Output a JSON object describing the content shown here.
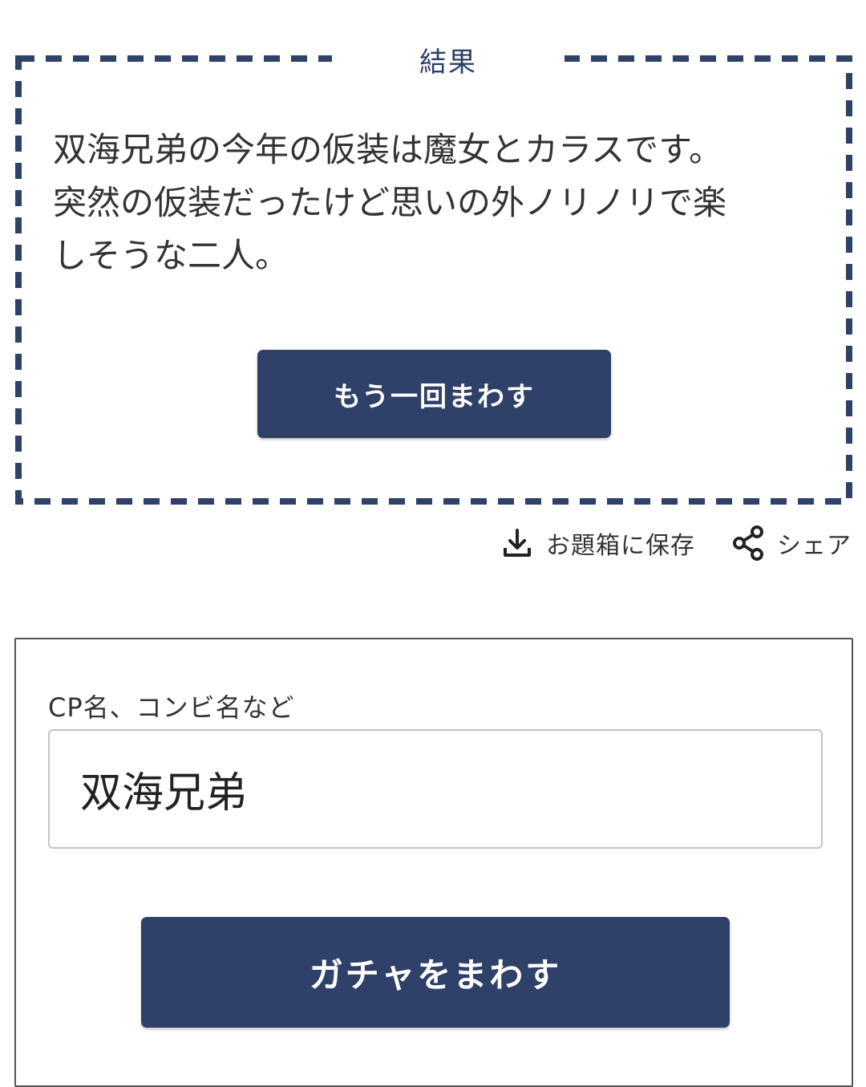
{
  "colors": {
    "accent": "#2f4169",
    "title_text": "#2c3e6b",
    "button_text": "#ffffff",
    "body_text": "#333333"
  },
  "result": {
    "title": "結果",
    "lines": [
      "双海兄弟の今年の仮装は魔女とカラスです。",
      "突然の仮装だったけど思いの外ノリノリで楽",
      "しそうな二人。"
    ],
    "retry_button_label": "もう一回まわす"
  },
  "actions": {
    "save": {
      "icon": "download-icon",
      "label": "お題箱に保存"
    },
    "share": {
      "icon": "share-icon",
      "label": "シェア"
    }
  },
  "form": {
    "field_label": "CP名、コンビ名など",
    "input_value": "双海兄弟",
    "submit_button_label": "ガチャをまわす"
  }
}
